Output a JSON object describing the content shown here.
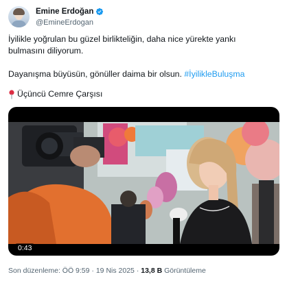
{
  "author": {
    "display_name": "Emine Erdoğan",
    "handle": "@EmineErdogan",
    "verified_icon": "verified-badge-icon"
  },
  "post": {
    "paragraph_1": "İyilikle yoğrulan bu güzel birlikteliğin, daha nice yürekte yankı bulmasını diliyorum.",
    "paragraph_2_text": "Dayanışma büyüsün, gönüller daima bir olsun. ",
    "hashtag": "#İyilikleBuluşma",
    "location_icon": "red-pin-icon",
    "location_text": "Üçüncü Cemre Çarşısı"
  },
  "media": {
    "type": "video",
    "duration": "0:43"
  },
  "footer": {
    "edited_label": "Son düzenleme: ÖÖ 9:59",
    "separator": "·",
    "date": "19 Nis 2025",
    "views_count": "13,8 B",
    "views_label": "Görüntüleme"
  },
  "colors": {
    "link": "#1d9bf0",
    "verified": "#1d9bf0",
    "secondary_text": "#536471"
  }
}
